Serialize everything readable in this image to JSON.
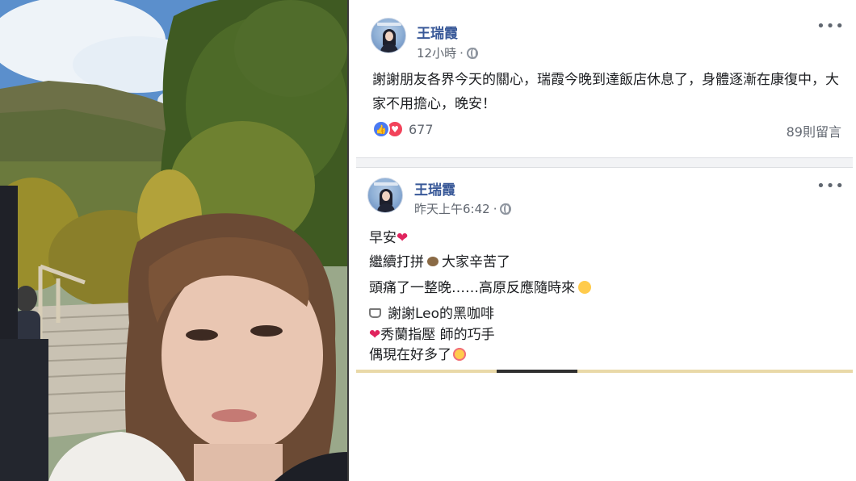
{
  "photo": {
    "description_icon": "selfie-photo"
  },
  "posts": [
    {
      "author": "王瑞霞",
      "time": "12小時",
      "privacy_icon": "globe-icon",
      "text": "謝謝朋友各界今天的關心，瑞霞今晚到達飯店休息了，身體逐漸在康復中，大家不用擔心，晚安！",
      "reaction_count": "677",
      "comment_count": "89則留言"
    },
    {
      "author": "王瑞霞",
      "time": "昨天上午6:42",
      "privacy_icon": "globe-icon",
      "lines": {
        "line1": "早安",
        "line2a": "繼續打拼",
        "line2b": "大家辛苦了",
        "line3": "頭痛了一整晚……高原反應隨時來",
        "line4": "謝謝Leo的黑咖啡",
        "line5": "秀蘭指壓 師的巧手",
        "line6": "偶現在好多了"
      }
    }
  ],
  "colors": {
    "author_link": "#385898",
    "meta_gray": "#616770",
    "like_blue": "#4a7af2",
    "love_red": "#f2435b"
  }
}
